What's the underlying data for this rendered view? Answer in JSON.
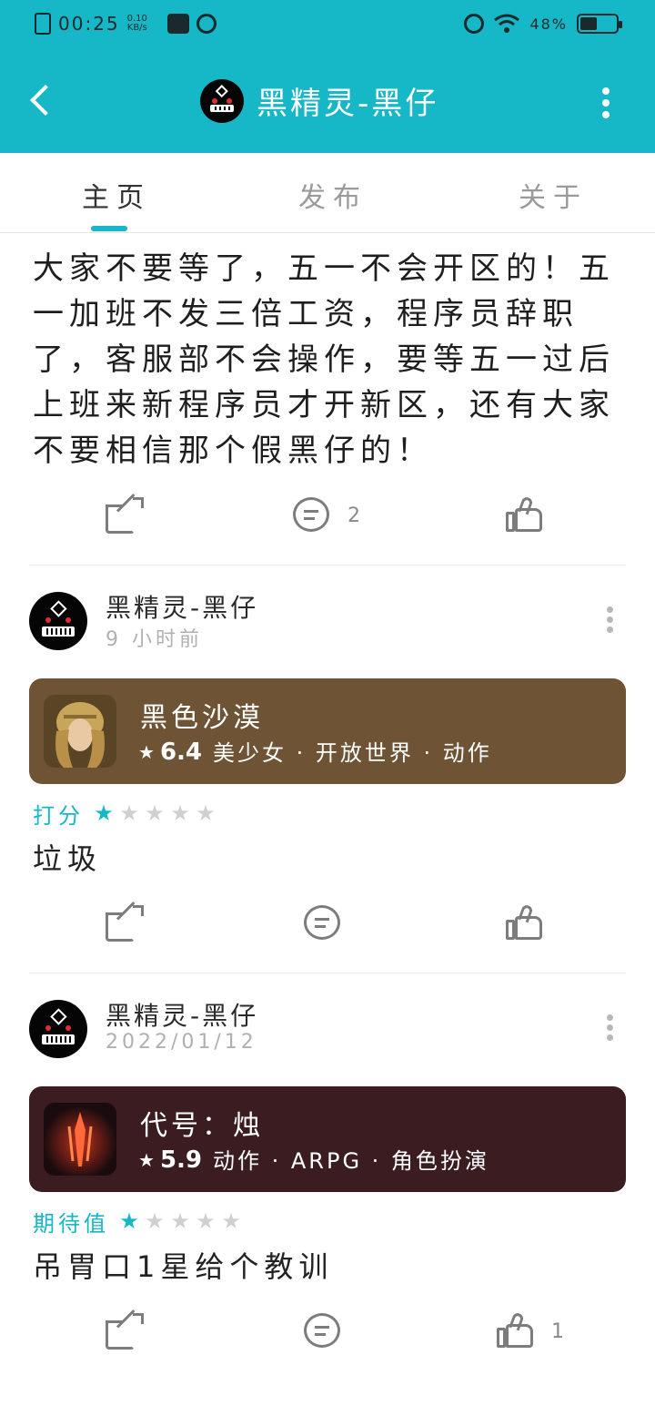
{
  "status_bar": {
    "time": "00:25",
    "net_speed": "0.10",
    "net_unit": "KB/s",
    "battery_text": "48%",
    "battery_level": 0.48
  },
  "header": {
    "title": "黑精灵-黑仔"
  },
  "tabs": [
    {
      "label": "主页",
      "active": true
    },
    {
      "label": "发布",
      "active": false
    },
    {
      "label": "关于",
      "active": false
    }
  ],
  "post": {
    "text": "大家不要等了，五一不会开区的！五一加班不发三倍工资，程序员辞职了，客服部不会操作，要等五一过后上班来新程序员才开新区，还有大家不要相信那个假黑仔的！",
    "comment_count": "2",
    "like_count": ""
  },
  "reviews": [
    {
      "user_name": "黑精灵-黑仔",
      "time": "9 小时前",
      "game": {
        "name": "黑色沙漠",
        "score": "6.4",
        "tags": "美少女 · 开放世界 · 动作",
        "card_color": "#6e5335"
      },
      "rating_label": "打分",
      "rating": 1,
      "rating_max": 5,
      "text": "垃圾",
      "comment_count": "",
      "like_count": ""
    },
    {
      "user_name": "黑精灵-黑仔",
      "time": "2022/01/12",
      "game": {
        "name": "代号：烛",
        "score": "5.9",
        "tags": "动作 · ARPG · 角色扮演",
        "card_color": "#3a1c21"
      },
      "rating_label": "期待值",
      "rating": 1,
      "rating_max": 5,
      "text": "吊胃口1星给个教训",
      "comment_count": "",
      "like_count": "1"
    }
  ],
  "colors": {
    "accent": "#16b7c6",
    "header_bg": "#16b7c6",
    "icon_gray": "#7c7c7c"
  },
  "icons": [
    "back-icon",
    "more-vertical-icon",
    "share-icon",
    "comment-icon",
    "like-icon",
    "star-icon",
    "alarm-icon",
    "wifi-icon",
    "battery-icon"
  ]
}
